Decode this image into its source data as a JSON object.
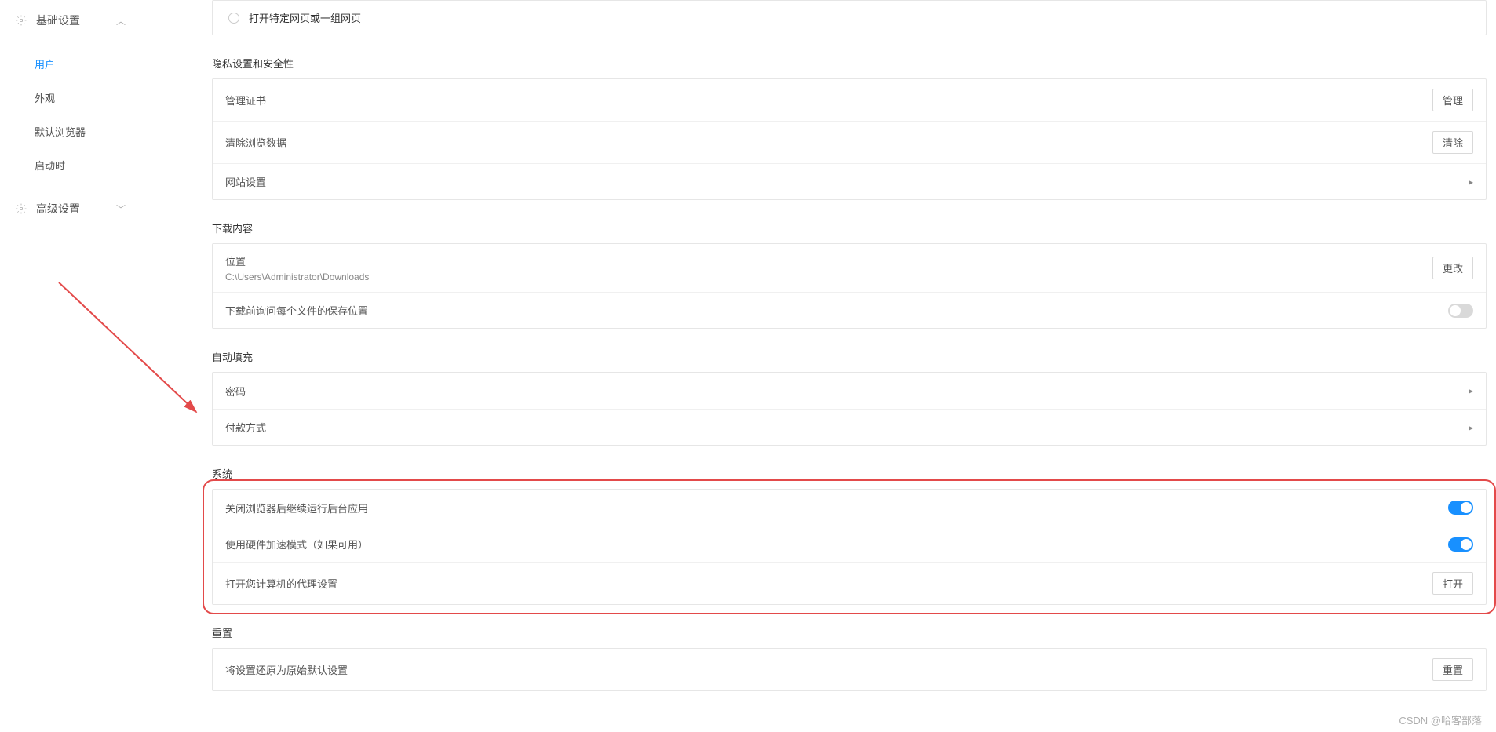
{
  "sidebar": {
    "basic": {
      "label": "基础设置"
    },
    "items": [
      {
        "label": "用户",
        "active": true
      },
      {
        "label": "外观"
      },
      {
        "label": "默认浏览器"
      },
      {
        "label": "启动时"
      }
    ],
    "advanced": {
      "label": "高级设置"
    }
  },
  "startup_card": {
    "radio_open_specific": "打开特定网页或一组网页"
  },
  "privacy": {
    "title": "隐私设置和安全性",
    "manage_certs": "管理证书",
    "manage_btn": "管理",
    "clear_data": "清除浏览数据",
    "clear_btn": "清除",
    "site_settings": "网站设置"
  },
  "downloads": {
    "title": "下载内容",
    "location_label": "位置",
    "location_path": "C:\\Users\\Administrator\\Downloads",
    "change_btn": "更改",
    "ask_each": "下载前询问每个文件的保存位置"
  },
  "autofill": {
    "title": "自动填充",
    "password": "密码",
    "payment": "付款方式"
  },
  "system": {
    "title": "系统",
    "bg_apps": "关闭浏览器后继续运行后台应用",
    "hw_accel": "使用硬件加速模式（如果可用）",
    "proxy": "打开您计算机的代理设置",
    "open_btn": "打开"
  },
  "reset": {
    "title": "重置",
    "restore": "将设置还原为原始默认设置",
    "reset_btn": "重置"
  },
  "watermark": "CSDN @哈客部落"
}
